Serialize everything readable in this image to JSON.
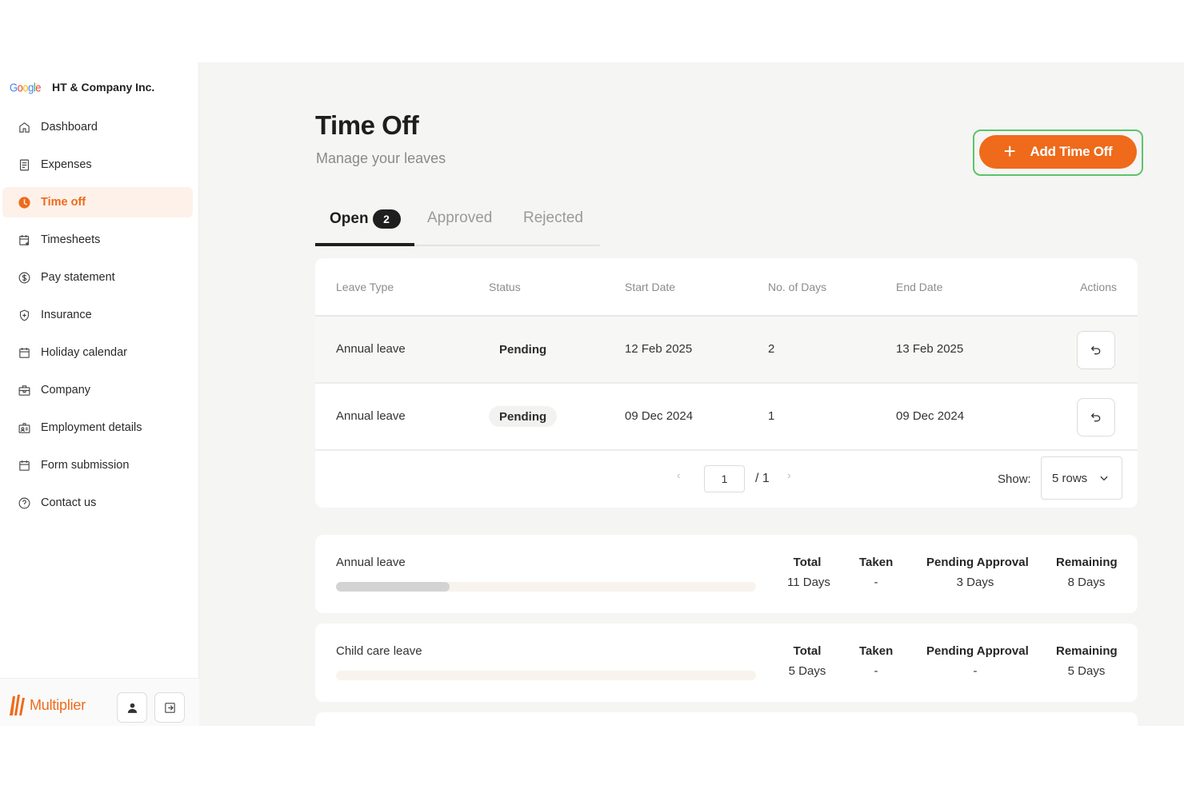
{
  "sidebar": {
    "company_logo_text": "Google",
    "company_name": "HT & Company Inc.",
    "items": [
      {
        "label": "Dashboard",
        "icon": "home-icon",
        "active": false
      },
      {
        "label": "Expenses",
        "icon": "receipt-icon",
        "active": false
      },
      {
        "label": "Time off",
        "icon": "clock-icon",
        "active": true
      },
      {
        "label": "Timesheets",
        "icon": "calendar-add-icon",
        "active": false
      },
      {
        "label": "Pay statement",
        "icon": "dollar-circle-icon",
        "active": false
      },
      {
        "label": "Insurance",
        "icon": "shield-plus-icon",
        "active": false
      },
      {
        "label": "Holiday calendar",
        "icon": "calendar-icon",
        "active": false
      },
      {
        "label": "Company",
        "icon": "building-icon",
        "active": false
      },
      {
        "label": "Employment details",
        "icon": "id-card-icon",
        "active": false
      },
      {
        "label": "Form submission",
        "icon": "calendar-form-icon",
        "active": false
      },
      {
        "label": "Contact us",
        "icon": "help-circle-icon",
        "active": false
      }
    ],
    "brand_name": "Multiplier"
  },
  "header": {
    "title": "Time Off",
    "subtitle": "Manage your leaves",
    "add_button_label": "Add Time Off"
  },
  "tabs": [
    {
      "label": "Open",
      "count": "2",
      "active": true
    },
    {
      "label": "Approved",
      "active": false
    },
    {
      "label": "Rejected",
      "active": false
    }
  ],
  "table": {
    "columns": [
      "Leave Type",
      "Status",
      "Start Date",
      "No. of Days",
      "End Date",
      "Actions"
    ],
    "rows": [
      {
        "leave_type": "Annual leave",
        "status": "Pending",
        "start_date": "12 Feb 2025",
        "days": "2",
        "end_date": "13 Feb 2025"
      },
      {
        "leave_type": "Annual leave",
        "status": "Pending",
        "start_date": "09 Dec 2024",
        "days": "1",
        "end_date": "09 Dec 2024"
      }
    ],
    "pagination": {
      "current_page": "1",
      "total_pages": "/ 1",
      "show_label": "Show:",
      "rows_option": "5 rows"
    }
  },
  "balances": [
    {
      "name": "Annual leave",
      "used_fraction": 0.27,
      "total_label": "Total",
      "total": "11 Days",
      "taken_label": "Taken",
      "taken": "-",
      "pending_label": "Pending Approval",
      "pending": "3 Days",
      "remaining_label": "Remaining",
      "remaining": "8 Days"
    },
    {
      "name": "Child care leave",
      "used_fraction": 0,
      "total_label": "Total",
      "total": "5 Days",
      "taken_label": "Taken",
      "taken": "-",
      "pending_label": "Pending Approval",
      "pending": "-",
      "remaining_label": "Remaining",
      "remaining": "5 Days"
    }
  ],
  "colors": {
    "accent": "#ef6a1a",
    "highlight_outline": "#5cc46a",
    "dark": "#1f1f1f"
  }
}
